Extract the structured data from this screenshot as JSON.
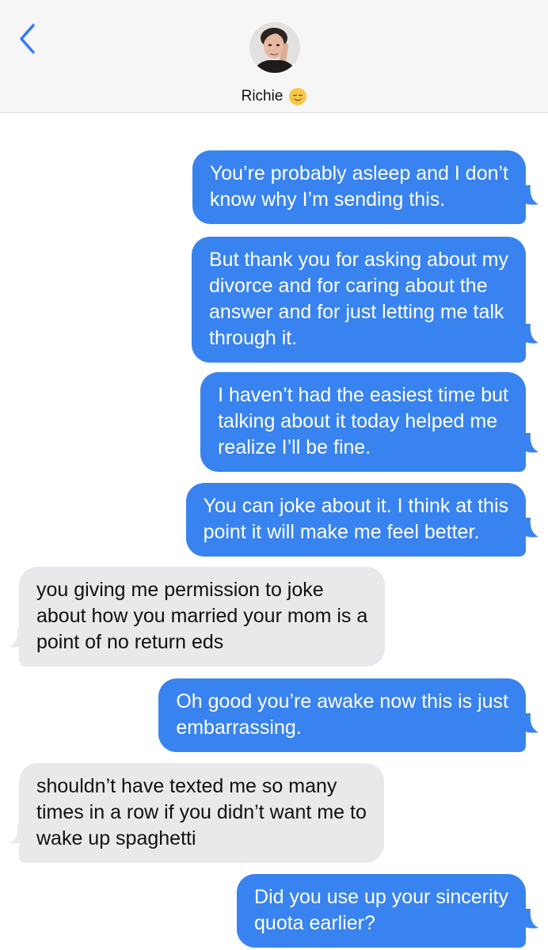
{
  "header": {
    "contact_name": "Richie",
    "emoji": "relieved-face-emoji",
    "back_icon": "chevron-left-icon"
  },
  "colors": {
    "sent_bubble": "#3883ef",
    "received_bubble": "#e9e9ec",
    "accent": "#2f7cf6"
  },
  "messages": [
    {
      "sender": "me",
      "lines": [
        "You’re probably asleep and I don’t",
        "know why I’m sending this."
      ]
    },
    {
      "sender": "me",
      "lines": [
        "But thank you for asking about my",
        "divorce and for caring about the",
        "answer and for just letting me talk",
        "through it."
      ]
    },
    {
      "sender": "me",
      "lines": [
        "I haven’t had the easiest time but",
        "talking about it today helped me",
        "realize I’ll be fine."
      ]
    },
    {
      "sender": "me",
      "lines": [
        "You can joke about it. I think at this",
        "point it will make me feel better."
      ]
    },
    {
      "sender": "them",
      "lines": [
        "you giving me permission to joke",
        "about how you married your mom is a",
        "point of no return eds"
      ]
    },
    {
      "sender": "me",
      "lines": [
        "Oh good you’re awake now this is just",
        "embarrassing."
      ]
    },
    {
      "sender": "them",
      "lines": [
        "shouldn’t have texted me so many",
        "times in a row if you didn’t want me to",
        "wake up spaghetti"
      ]
    },
    {
      "sender": "me",
      "lines": [
        "Did you use up your sincerity",
        "quota earlier?"
      ]
    }
  ]
}
